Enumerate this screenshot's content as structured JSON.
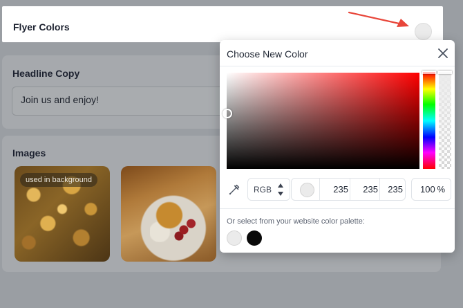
{
  "flyer": {
    "title": "Flyer Colors",
    "current_color": "#ebebeb"
  },
  "headline": {
    "title": "Headline Copy",
    "value": "Join us and enjoy!"
  },
  "images": {
    "title": "Images",
    "badge": "used in background"
  },
  "picker": {
    "title": "Choose New Color",
    "mode": "RGB",
    "r": "235",
    "g": "235",
    "b": "235",
    "alpha": "100",
    "alpha_unit": "%",
    "palette_label": "Or select from your website color palette:",
    "palette": [
      "#ebebeb",
      "#0a0a0a"
    ]
  },
  "colors": {
    "annotation_arrow": "#e8463a",
    "hue": "#ff0000"
  }
}
